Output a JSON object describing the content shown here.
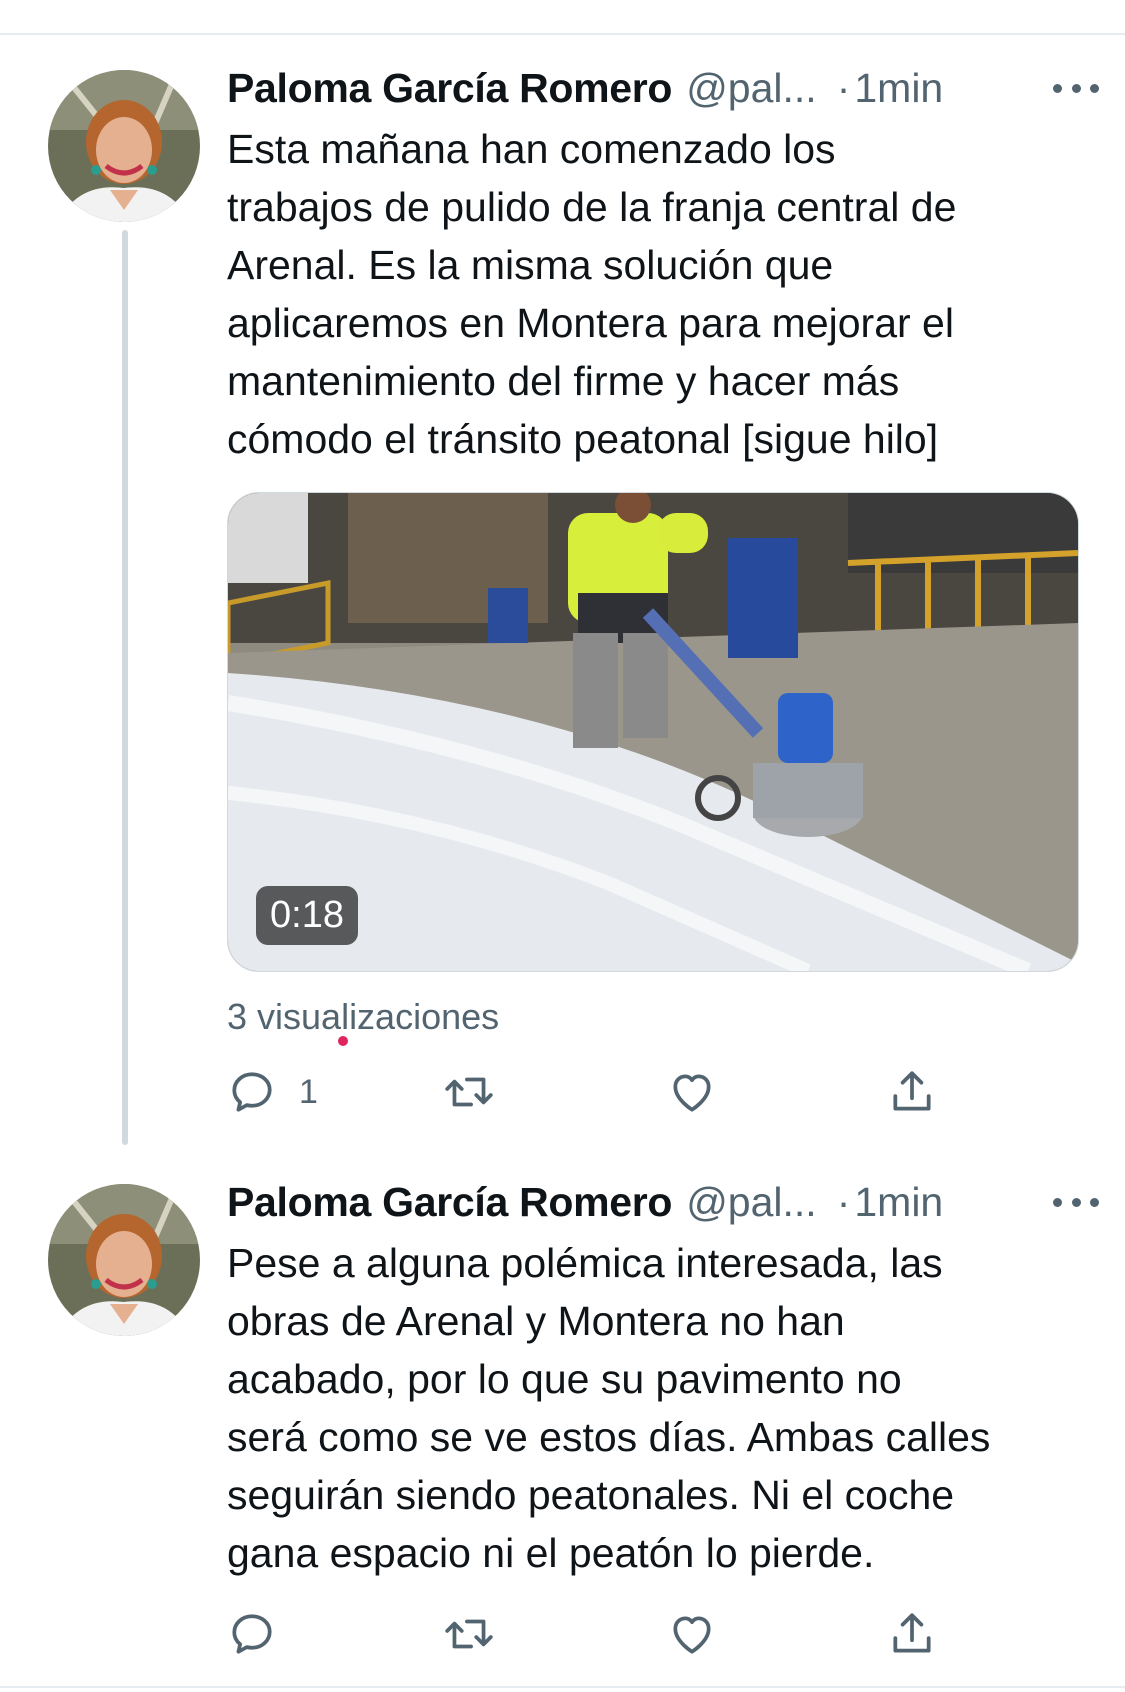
{
  "tweets": [
    {
      "author_name": "Paloma García Romero",
      "handle": "@pal...",
      "separator": "·",
      "time": "1min",
      "text_lines": [
        "Esta mañana han comenzado los",
        "trabajos de pulido de la franja central de",
        "Arenal. Es la misma solución que",
        "aplicaremos en Montera para mejorar el",
        "mantenimiento del firme y hacer más",
        "cómodo el tránsito peatonal [sigue hilo]"
      ],
      "video_duration": "0:18",
      "views": "3 visualizaciones",
      "actions": {
        "reply_count": "1",
        "reply_icon": "reply-icon",
        "retweet_icon": "retweet-icon",
        "like_icon": "heart-icon",
        "share_icon": "share-icon"
      }
    },
    {
      "author_name": "Paloma García Romero",
      "handle": "@pal...",
      "separator": "·",
      "time": "1min",
      "text_lines": [
        "Pese a alguna polémica interesada, las",
        "obras de Arenal y Montera no han",
        "acabado, por lo que su pavimento no",
        "será como se ve estos días. Ambas calles",
        "seguirán siendo peatonales. Ni el coche",
        "gana espacio ni el peatón lo pierde."
      ],
      "actions": {
        "reply_icon": "reply-icon",
        "retweet_icon": "retweet-icon",
        "like_icon": "heart-icon",
        "share_icon": "share-icon"
      }
    }
  ],
  "colors": {
    "text_primary": "#0f1419",
    "text_secondary": "#536471",
    "divider": "#e6ecf0",
    "thread_line": "#cfd9de"
  }
}
